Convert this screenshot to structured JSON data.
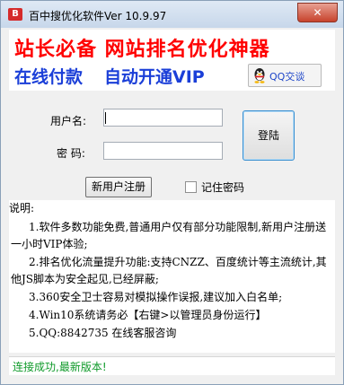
{
  "window": {
    "app_icon_text": "B",
    "title": "百中搜优化软件Ver 10.9.97",
    "close_label": "✕"
  },
  "banner": {
    "line1": "站长必备  网站排名优化神器",
    "line2_a": "在线付款",
    "line2_b": "自动开通VIP",
    "qq_button_label": "QQ交谈"
  },
  "login": {
    "username_label": "用户名:",
    "username_value": "",
    "password_label": "密  码:",
    "password_value": "",
    "login_button": "登陆",
    "register_button": "新用户注册",
    "remember_label": "记住密码",
    "remember_checked": false
  },
  "notes": {
    "title": "说明:",
    "items": [
      "1.软件多数功能免费,普通用户仅有部分功能限制,新用户注册送一小时VIP体验;",
      "2.排名优化流量提升功能:支持CNZZ、百度统计等主流统计,其他JS脚本为安全起见,已经屏蔽;",
      "3.360安全卫士容易对模拟操作误报,建议加入白名单;",
      "4.Win10系统请务必【右键>以管理员身份运行】",
      "5.QQ:8842735 在线客服咨询"
    ]
  },
  "status": {
    "text": "连接成功,最新版本!"
  },
  "colors": {
    "banner_red": "#ff0000",
    "banner_blue": "#1b3fd8",
    "status_green": "#0f9a2a"
  }
}
